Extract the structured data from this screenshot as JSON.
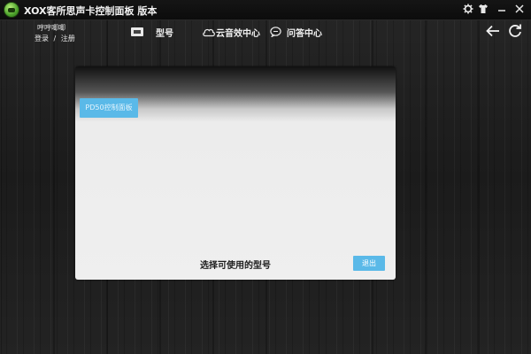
{
  "window": {
    "title": "XOX客所思声卡控制面板  版本"
  },
  "user": {
    "name": "哼哼唧唧",
    "login": "登录",
    "separator": "/",
    "register": "注册"
  },
  "nav": [
    {
      "label": "型号",
      "icon": "device-icon"
    },
    {
      "label": "云音效中心",
      "icon": "cloud-icon"
    },
    {
      "label": "问答中心",
      "icon": "chat-bubble-icon"
    }
  ],
  "panel": {
    "model_button": "PD50控制面板",
    "caption": "选择可使用的型号",
    "exit_button": "退出"
  },
  "colors": {
    "accent": "#5ab9e8",
    "panel_bg": "#efefef"
  }
}
